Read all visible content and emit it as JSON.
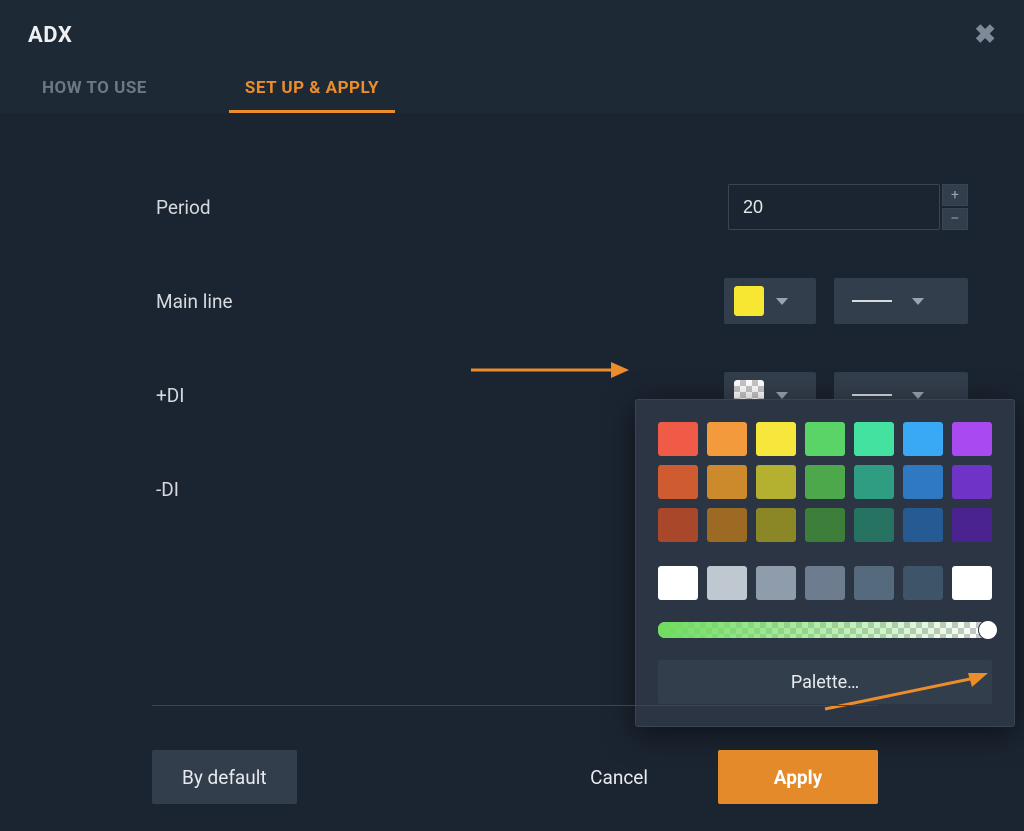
{
  "dialog": {
    "title": "ADX",
    "tabs": {
      "how_to_use": "HOW TO USE",
      "setup": "SET UP & APPLY"
    }
  },
  "settings": {
    "period": {
      "label": "Period",
      "value": "20"
    },
    "main_line": {
      "label": "Main line",
      "color": "#f7e733"
    },
    "plus_di": {
      "label": "+DI"
    },
    "minus_di": {
      "label": "-DI"
    }
  },
  "picker": {
    "palette_button": "Palette…",
    "colors_row1": [
      "#ef5b46",
      "#f29a3c",
      "#f7e73c",
      "#5ad466",
      "#44e2a1",
      "#39a9f6",
      "#a94af0"
    ],
    "colors_row2": [
      "#cf5b31",
      "#cc8a2d",
      "#b3b12f",
      "#4ca84a",
      "#2e9d82",
      "#2f79c2",
      "#6f34c7"
    ],
    "colors_row3": [
      "#a8472a",
      "#9d6a24",
      "#8b8726",
      "#3d7f3a",
      "#267361",
      "#255a93",
      "#4a2390"
    ],
    "neutrals": [
      "#ffffff",
      "#bfc8d1",
      "#8e9cab",
      "#6d7d8f",
      "#566a7e",
      "#3e5468",
      "#ffffff"
    ]
  },
  "footer": {
    "by_default": "By default",
    "cancel": "Cancel",
    "apply": "Apply"
  }
}
